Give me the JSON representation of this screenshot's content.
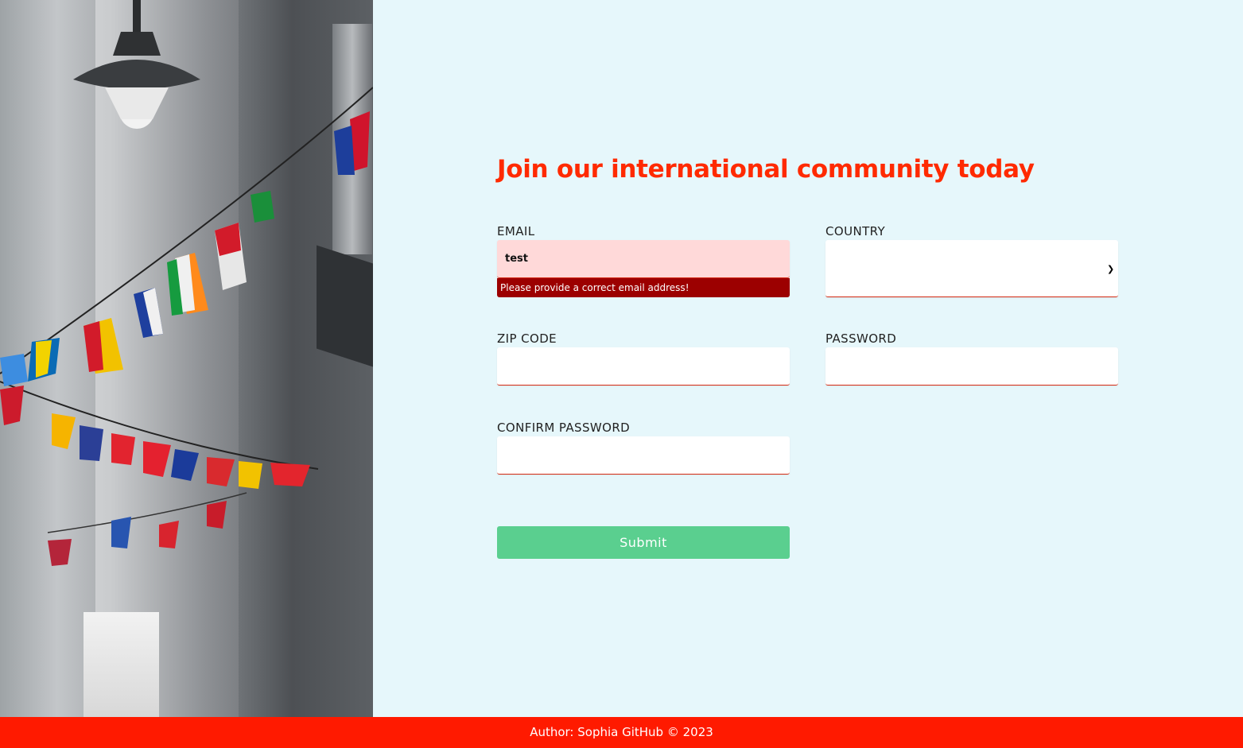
{
  "form": {
    "title": "Join our international community today",
    "email": {
      "label": "EMAIL",
      "value": "test",
      "error": "Please provide a correct email address!"
    },
    "country": {
      "label": "COUNTRY",
      "value": ""
    },
    "zip": {
      "label": "ZIP CODE",
      "value": ""
    },
    "password": {
      "label": "PASSWORD",
      "value": ""
    },
    "confirm": {
      "label": "CONFIRM PASSWORD",
      "value": ""
    },
    "submit_label": "Submit"
  },
  "footer": {
    "text": "Author: Sophia GitHub © 2023"
  },
  "colors": {
    "accent": "#ff2a00",
    "error_bg": "#9c0000",
    "invalid_input_bg": "#ffd9d9",
    "submit_bg": "#5acf8f",
    "page_bg": "#e6f7fb",
    "footer_bg": "#ff1a00"
  },
  "image": {
    "description_icon": "alley-flags-photo"
  }
}
